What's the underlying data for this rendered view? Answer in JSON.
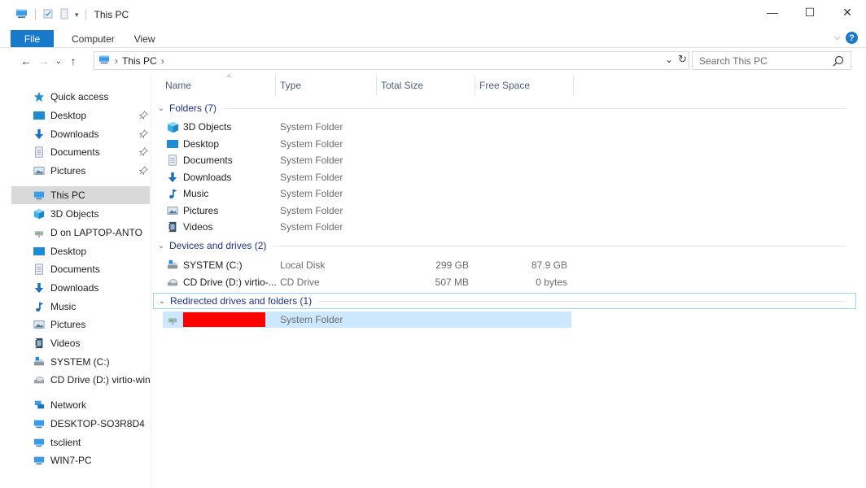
{
  "window": {
    "title": "This PC",
    "controls": {
      "minimize": "—",
      "maximize": "☐",
      "close": "✕"
    }
  },
  "ribbon": {
    "tabs": [
      "File",
      "Computer",
      "View"
    ],
    "help": "?"
  },
  "address": {
    "crumbs": [
      "This PC"
    ],
    "search_placeholder": "Search This PC"
  },
  "navpane": {
    "quick_access": {
      "label": "Quick access",
      "items": [
        "Desktop",
        "Downloads",
        "Documents",
        "Pictures"
      ]
    },
    "this_pc": {
      "label": "This PC",
      "items": [
        "3D Objects",
        "D on LAPTOP-ANTO",
        "Desktop",
        "Documents",
        "Downloads",
        "Music",
        "Pictures",
        "Videos",
        "SYSTEM (C:)",
        "CD Drive (D:) virtio-win-"
      ]
    },
    "network": {
      "label": "Network",
      "items": [
        "DESKTOP-SO3R8D4",
        "tsclient",
        "WIN7-PC"
      ]
    }
  },
  "columns": {
    "name": "Name",
    "type": "Type",
    "total": "Total Size",
    "free": "Free Space"
  },
  "groups": {
    "folders": {
      "header": "Folders (7)",
      "rows": [
        {
          "name": "3D Objects",
          "type": "System Folder",
          "icon": "3d-objects-icon"
        },
        {
          "name": "Desktop",
          "type": "System Folder",
          "icon": "desktop-icon"
        },
        {
          "name": "Documents",
          "type": "System Folder",
          "icon": "documents-icon"
        },
        {
          "name": "Downloads",
          "type": "System Folder",
          "icon": "downloads-icon"
        },
        {
          "name": "Music",
          "type": "System Folder",
          "icon": "music-icon"
        },
        {
          "name": "Pictures",
          "type": "System Folder",
          "icon": "pictures-icon"
        },
        {
          "name": "Videos",
          "type": "System Folder",
          "icon": "videos-icon"
        }
      ]
    },
    "devices": {
      "header": "Devices and drives (2)",
      "rows": [
        {
          "name": "SYSTEM (C:)",
          "type": "Local Disk",
          "total": "299 GB",
          "free": "87.9 GB",
          "icon": "local-disk-icon"
        },
        {
          "name": "CD Drive (D:) virtio-...",
          "type": "CD Drive",
          "total": "507 MB",
          "free": "0 bytes",
          "icon": "cd-drive-icon"
        }
      ]
    },
    "redirected": {
      "header": "Redirected drives and folders (1)",
      "rows": [
        {
          "name": "",
          "type": "System Folder",
          "icon": "network-drive-icon"
        }
      ]
    }
  }
}
